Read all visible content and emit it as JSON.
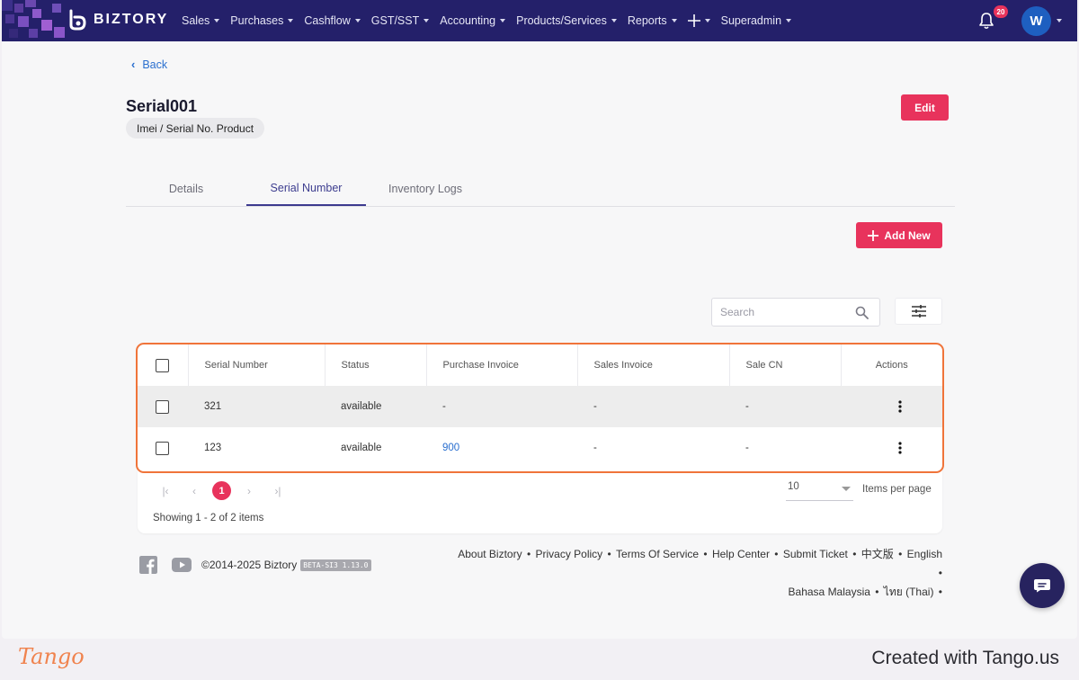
{
  "navbar": {
    "brand": "BIZTORY",
    "menu": [
      {
        "label": "Sales",
        "has_caret": true
      },
      {
        "label": "Purchases",
        "has_caret": true
      },
      {
        "label": "Cashflow",
        "has_caret": true
      },
      {
        "label": "GST/SST",
        "has_caret": true
      },
      {
        "label": "Accounting",
        "has_caret": true
      },
      {
        "label": "Products/Services",
        "has_caret": true
      },
      {
        "label": "Reports",
        "has_caret": true
      }
    ],
    "quick_add_icon": "plus-icon",
    "superadmin": "Superadmin",
    "notification_count": "20",
    "avatar_initial": "W"
  },
  "page": {
    "back_label": "Back",
    "title": "Serial001",
    "product_type": "Imei / Serial No. Product",
    "edit_label": "Edit"
  },
  "tabs": [
    {
      "label": "Details",
      "active": false
    },
    {
      "label": "Serial Number",
      "active": true
    },
    {
      "label": "Inventory Logs",
      "active": false
    }
  ],
  "toolbar": {
    "add_new_label": "Add New",
    "search_placeholder": "Search"
  },
  "table": {
    "columns": [
      "Serial Number",
      "Status",
      "Purchase Invoice",
      "Sales Invoice",
      "Sale CN",
      "Actions"
    ],
    "rows": [
      {
        "serial": "321",
        "status": "available",
        "purchase_invoice": "-",
        "sales_invoice": "-",
        "sale_cn": "-"
      },
      {
        "serial": "123",
        "status": "available",
        "purchase_invoice": "900",
        "sales_invoice": "-",
        "sale_cn": "-"
      }
    ]
  },
  "pagination": {
    "current_page": "1",
    "items_per_page": "10",
    "items_per_page_label": "Items per page",
    "showing": "Showing 1 - 2 of 2 items"
  },
  "footer": {
    "copyright": "©2014-2025 Biztory",
    "version": "BETA-SI3 1.13.0",
    "links": [
      "About Biztory",
      "Privacy Policy",
      "Terms Of Service",
      "Help Center",
      "Submit Ticket",
      "中文版",
      "English",
      "Bahasa Malaysia",
      "ไทย (Thai)"
    ]
  },
  "tango": {
    "logo": "Tango",
    "created": "Created with Tango.us"
  },
  "colors": {
    "navbar": "#24206a",
    "accent": "#e8335c",
    "link": "#2a6fcf",
    "highlight": "#f0743a"
  }
}
